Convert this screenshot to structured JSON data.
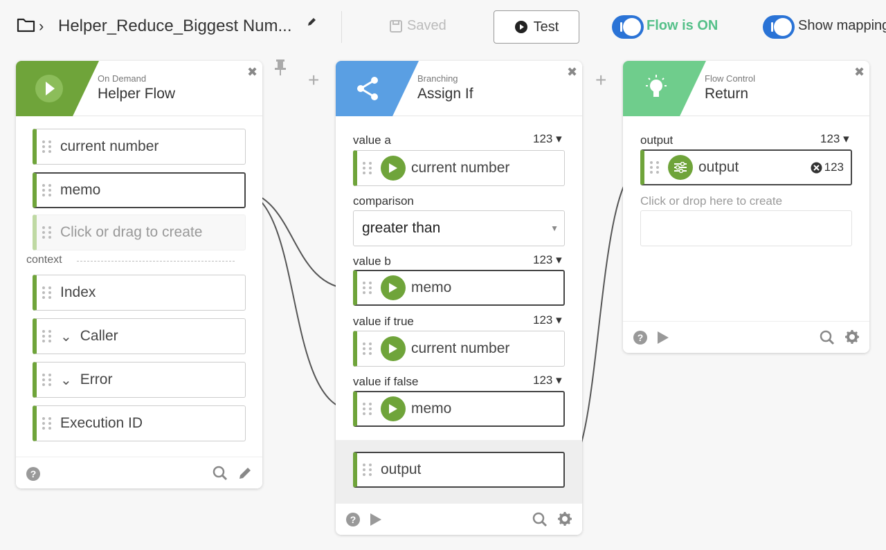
{
  "header": {
    "title": "Helper_Reduce_Biggest Num...",
    "saved_label": "Saved",
    "test_label": "Test",
    "flow_status": "Flow is ON",
    "show_mapping": "Show mapping"
  },
  "cards": {
    "helper": {
      "subtitle": "On Demand",
      "title": "Helper Flow",
      "fields": [
        "current number",
        "memo"
      ],
      "create_placeholder": "Click or drag to create",
      "context_label": "context",
      "context_fields": [
        "Index",
        "Caller",
        "Error",
        "Execution ID"
      ]
    },
    "assign": {
      "subtitle": "Branching",
      "title": "Assign If",
      "value_a_label": "value a",
      "value_a_type": "123",
      "value_a": "current number",
      "comparison_label": "comparison",
      "comparison": "greater than",
      "value_b_label": "value b",
      "value_b_type": "123",
      "value_b": "memo",
      "value_true_label": "value if true",
      "value_true_type": "123",
      "value_true": "current number",
      "value_false_label": "value if false",
      "value_false_type": "123",
      "value_false": "memo",
      "output": "output"
    },
    "return": {
      "subtitle": "Flow Control",
      "title": "Return",
      "output_label": "output",
      "output_type": "123",
      "output_field": "output",
      "output_badge": "123",
      "create_label": "Click or drop here to create"
    }
  },
  "colors": {
    "green_header": "#6fa43a",
    "blue_header": "#5a9fe3",
    "light_green_header": "#6fcd8c",
    "toggle_blue": "#2a73d6",
    "flow_on_green": "#55c089"
  }
}
